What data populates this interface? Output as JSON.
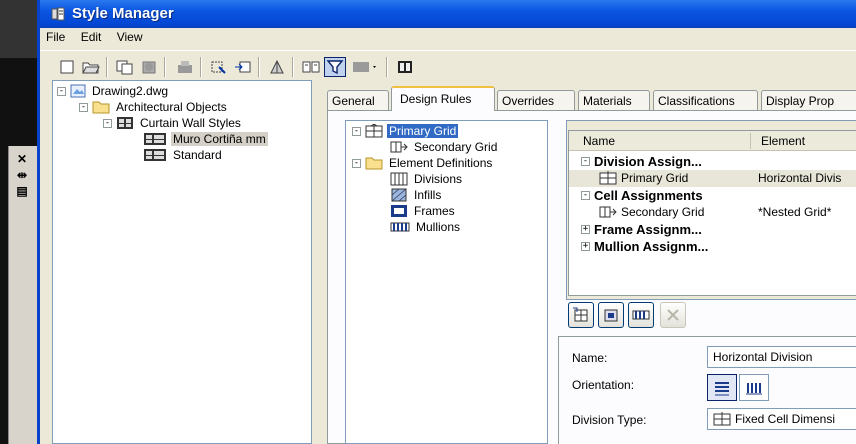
{
  "window": {
    "title": "Style Manager"
  },
  "menu": {
    "items": [
      "File",
      "Edit",
      "View"
    ]
  },
  "toolbar": {
    "icons": [
      "new-icon",
      "open-icon",
      "copy-icon",
      "paste-icon",
      "purge-icon",
      "edit-style-icon",
      "set-from-icon",
      "toggle-view-icon",
      "compare-icon",
      "filter-icon",
      "view-dropdown-icon",
      "inline-edit-icon"
    ]
  },
  "left_tree": {
    "items": [
      {
        "label": "Drawing2.dwg",
        "level": 0,
        "expander": "-",
        "icon": "drawing-icon"
      },
      {
        "label": "Architectural Objects",
        "level": 1,
        "expander": "-",
        "icon": "folder-icon"
      },
      {
        "label": "Curtain Wall Styles",
        "level": 2,
        "expander": "-",
        "icon": "curtain-wall-styles-icon"
      },
      {
        "label": "Muro Cortiña mm",
        "level": 3,
        "expander": "",
        "icon": "curtain-wall-style-icon",
        "selected": true
      },
      {
        "label": "Standard",
        "level": 3,
        "expander": "",
        "icon": "curtain-wall-style-icon"
      }
    ]
  },
  "tabs": [
    "General",
    "Design Rules",
    "Overrides",
    "Materials",
    "Classifications",
    "Display Prop"
  ],
  "active_tab": "Design Rules",
  "rule_tree": {
    "items": [
      {
        "label": "Primary Grid",
        "level": 0,
        "expander": "-",
        "icon": "grid-icon",
        "selected": true
      },
      {
        "label": "Secondary Grid",
        "level": 1,
        "icon": "nested-grid-icon"
      },
      {
        "label": "Element Definitions",
        "level": 0,
        "expander": "-",
        "icon": "folder-icon"
      },
      {
        "label": "Divisions",
        "level": 1,
        "icon": "divisions-icon"
      },
      {
        "label": "Infills",
        "level": 1,
        "icon": "infills-icon"
      },
      {
        "label": "Frames",
        "level": 1,
        "icon": "frames-icon"
      },
      {
        "label": "Mullions",
        "level": 1,
        "icon": "mullions-icon"
      }
    ]
  },
  "grid": {
    "columns": [
      "Name",
      "Element"
    ],
    "rows": [
      {
        "type": "group",
        "expander": "-",
        "name": "Division Assign...",
        "element": ""
      },
      {
        "type": "item",
        "name": "Primary Grid",
        "element": "Horizontal Divis",
        "selected": true
      },
      {
        "type": "group",
        "expander": "-",
        "name": "Cell Assignments",
        "element": ""
      },
      {
        "type": "item",
        "name": "Secondary Grid",
        "element": "*Nested Grid*"
      },
      {
        "type": "group",
        "expander": "+",
        "name": "Frame Assignm...",
        "element": ""
      },
      {
        "type": "group",
        "expander": "+",
        "name": "Mullion Assignm...",
        "element": ""
      }
    ]
  },
  "actions": [
    "new-assignment-icon",
    "open-assignment-icon",
    "mullion-assignment-icon",
    "delete-icon"
  ],
  "properties": {
    "name_label": "Name:",
    "name_value": "Horizontal Division",
    "orientation_label": "Orientation:",
    "orientation": "horizontal",
    "division_type_label": "Division Type:",
    "division_type_value": "Fixed Cell Dimensi"
  }
}
